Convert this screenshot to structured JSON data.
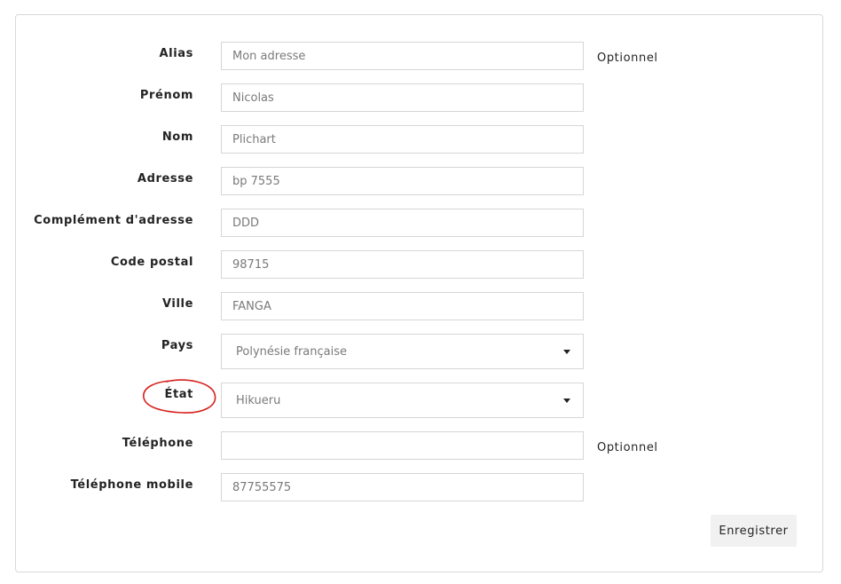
{
  "form": {
    "alias": {
      "label": "Alias",
      "value": "Mon adresse",
      "optional": "Optionnel"
    },
    "firstname": {
      "label": "Prénom",
      "value": "Nicolas"
    },
    "lastname": {
      "label": "Nom",
      "value": "Plichart"
    },
    "address": {
      "label": "Adresse",
      "value": "bp 7555"
    },
    "address2": {
      "label": "Complément d'adresse",
      "value": "DDD"
    },
    "postcode": {
      "label": "Code postal",
      "value": "98715"
    },
    "city": {
      "label": "Ville",
      "value": "FANGA"
    },
    "country": {
      "label": "Pays",
      "selected": "Polynésie française"
    },
    "state": {
      "label": "État",
      "selected": "Hikueru"
    },
    "phone": {
      "label": "Téléphone",
      "value": "",
      "optional": "Optionnel"
    },
    "mobile": {
      "label": "Téléphone mobile",
      "value": "87755575"
    },
    "save_label": "Enregistrer"
  },
  "annotation": {
    "color": "#d6201c"
  }
}
